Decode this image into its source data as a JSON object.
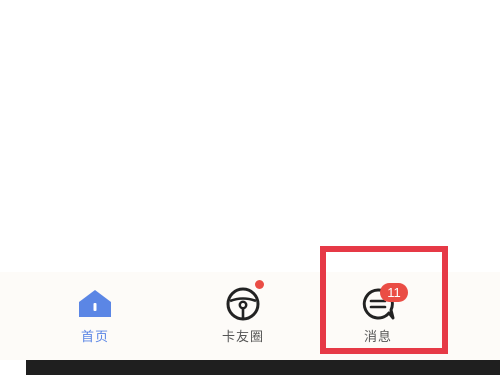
{
  "colors": {
    "accent": "#5b86e5",
    "badge": "#ea4d45",
    "highlight": "#e63946",
    "label": "#555555"
  },
  "tabbar": {
    "tabs": [
      {
        "id": "home",
        "label": "首页",
        "icon": "home-icon",
        "active": true
      },
      {
        "id": "circle",
        "label": "卡友圈",
        "icon": "steering-wheel-icon",
        "has_dot": true
      },
      {
        "id": "messages",
        "label": "消息",
        "icon": "chat-bubble-icon",
        "badge": "11"
      }
    ]
  }
}
